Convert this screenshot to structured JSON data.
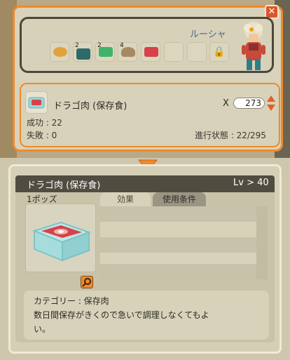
{
  "npc": {
    "name": "ルーシャ"
  },
  "ingredients": [
    {
      "qty": "",
      "color": "#e0a23b"
    },
    {
      "qty": "2",
      "color": "#2f6a6a"
    },
    {
      "qty": "2",
      "color": "#3fb36b"
    },
    {
      "qty": "4",
      "color": "#a68a62"
    },
    {
      "qty": "",
      "color": "#d7414a"
    }
  ],
  "craft": {
    "item_name": "ドラゴ肉 (保存食)",
    "x_label": "X",
    "quantity": "273",
    "success": "成功 : 22",
    "failure": "失敗 : 0",
    "progress": "進行状態 : 22/295"
  },
  "detail": {
    "title": "ドラゴ肉 (保存食)",
    "level": "Lv > 40",
    "portion": "1ポッズ",
    "tabs": {
      "effect": "効果",
      "conditions": "使用条件"
    },
    "category": "カテゴリー : 保存肉",
    "description_line1": "数日間保存がきくので急いで調理しなくてもよ",
    "description_line2": "い。"
  },
  "icons": {
    "close": "close-icon",
    "lock": "lock-icon",
    "zoom": "magnifier-icon",
    "stepper": "up-down-arrow-icon",
    "arrow": "chevron-down-icon"
  },
  "colors": {
    "accent": "#f08a2a",
    "header": "#504c40",
    "npc_name": "#4b6b80"
  }
}
